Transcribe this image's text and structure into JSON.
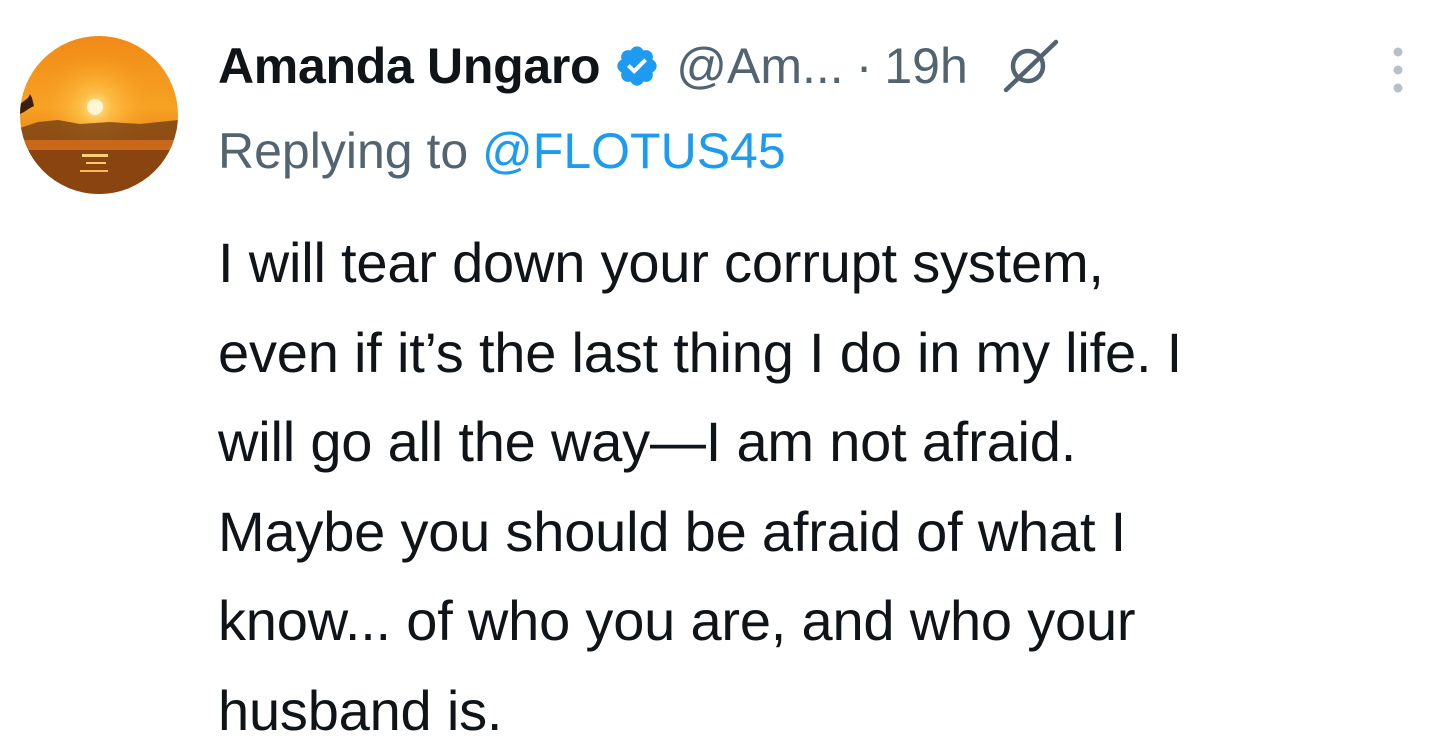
{
  "tweet": {
    "display_name": "Amanda Ungaro",
    "handle": "@Am...",
    "separator": "·",
    "time": "19h",
    "reply_prefix": "Replying to ",
    "reply_handle": "@FLOTUS45",
    "body_lines": [
      "I will tear down your corrupt system,",
      "even if it’s the last thing I do in my life. I",
      "will go all the way—I am not afraid.",
      "Maybe you should be afraid of what I",
      "know... of who you are, and who your",
      "husband is."
    ],
    "icons": {
      "verified": "verified-badge-icon",
      "edited": "edited-pencil-icon",
      "more": "more-options-icon"
    },
    "colors": {
      "verified_blue": "#1d9bf0",
      "link_blue": "#1d9bf0",
      "secondary_text": "#536471",
      "primary_text": "#0f1419"
    }
  }
}
